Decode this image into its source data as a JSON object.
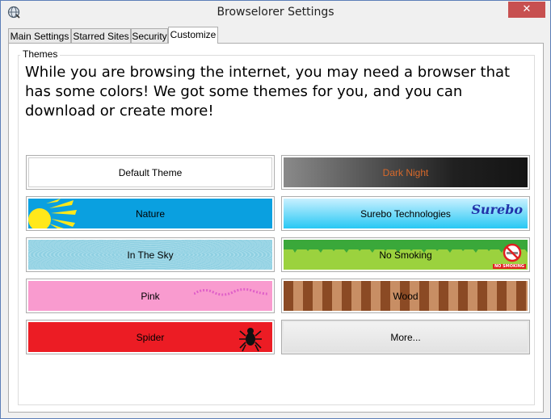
{
  "window": {
    "title": "Browselorer Settings"
  },
  "tabs": [
    {
      "label": "Main Settings"
    },
    {
      "label": "Starred Sites"
    },
    {
      "label": "Security"
    },
    {
      "label": "Customize"
    }
  ],
  "themes_group": {
    "label": "Themes",
    "intro": "While you are browsing the internet, you may need a browser that has some colors! We got some themes for you, and you can download or create more!"
  },
  "themes": [
    {
      "label": "Default Theme"
    },
    {
      "label": "Dark Night"
    },
    {
      "label": "Nature"
    },
    {
      "label": "Surebo Technologies"
    },
    {
      "label": "In The Sky"
    },
    {
      "label": "No Smoking"
    },
    {
      "label": "Pink"
    },
    {
      "label": "Wood"
    },
    {
      "label": "Spider"
    },
    {
      "label": "More..."
    }
  ],
  "surebo_logo": {
    "text": "Surebo"
  },
  "no_smoking_sign": {
    "text": "NO SMOKING"
  },
  "colors": {
    "dark_night_label": "#d8692a",
    "nature_bg": "#0aa0e0",
    "spider_bg": "#ec1c24",
    "pink_bg": "#f99bcf"
  }
}
